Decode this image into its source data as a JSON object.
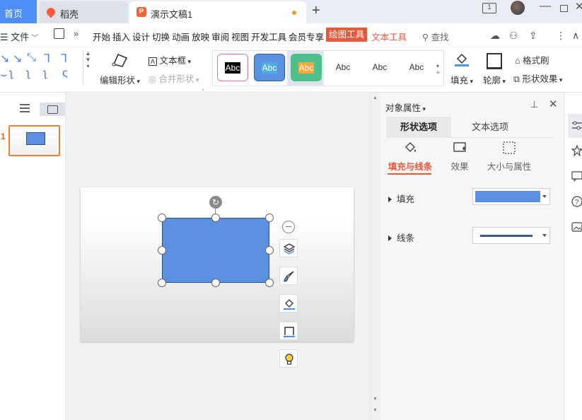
{
  "titlebar": {
    "home_tab": "首页",
    "tabs": [
      {
        "label": "稻壳",
        "icon": "daoke-icon"
      },
      {
        "label": "演示文稿1",
        "icon": "ppt-icon",
        "unsaved": true
      }
    ],
    "screen_badge": "1"
  },
  "menubar": {
    "file_label": "文件",
    "items": [
      "开始",
      "插入",
      "设计",
      "切换",
      "动画",
      "放映",
      "审阅",
      "视图",
      "开发工具",
      "会员专享"
    ],
    "active_item": "绘图工具",
    "text_tool": "文本工具",
    "search_label": "查找"
  },
  "ribbon": {
    "edit_shape": "编辑形状",
    "text_box": "文本框",
    "merge_shape": "合并形状",
    "style_presets": [
      {
        "label": "Abc",
        "fill": "#ffffff",
        "border": "#e07a8a",
        "text": "#333333"
      },
      {
        "label": "Abc",
        "fill": "#000000",
        "border": "#000000",
        "text": "#ffffff"
      },
      {
        "label": "Abc",
        "fill": "#5b8fe0",
        "border": "#2e5ab0",
        "text": "#ffffff"
      },
      {
        "label": "Abc",
        "fill": "#4aaee0",
        "border": "#4aaee0",
        "text": "#ffffff"
      },
      {
        "label": "Abc",
        "fill": "#4fc08a",
        "border": "#4fc08a",
        "text": "#ffffff"
      },
      {
        "label": "Abc",
        "fill": "#f7a93a",
        "border": "#f7a93a",
        "text": "#ffffff"
      }
    ],
    "fill_label": "填充",
    "outline_label": "轮廓",
    "format_painter": "格式刷",
    "shape_effects": "形状效果"
  },
  "slides": {
    "current_number": "1",
    "shape_fill": "#5b8fe0"
  },
  "property_pane": {
    "title": "对象属性",
    "tabs": [
      "形状选项",
      "文本选项"
    ],
    "subtabs": [
      "填充与线条",
      "效果",
      "大小与属性"
    ],
    "fill_label": "填充",
    "line_label": "线条",
    "fill_color": "#5b8fe0",
    "line_color": "#3e5a8a"
  },
  "colors": {
    "accent": "#e8593c",
    "home_tab_blue": "#4e8ef7"
  }
}
